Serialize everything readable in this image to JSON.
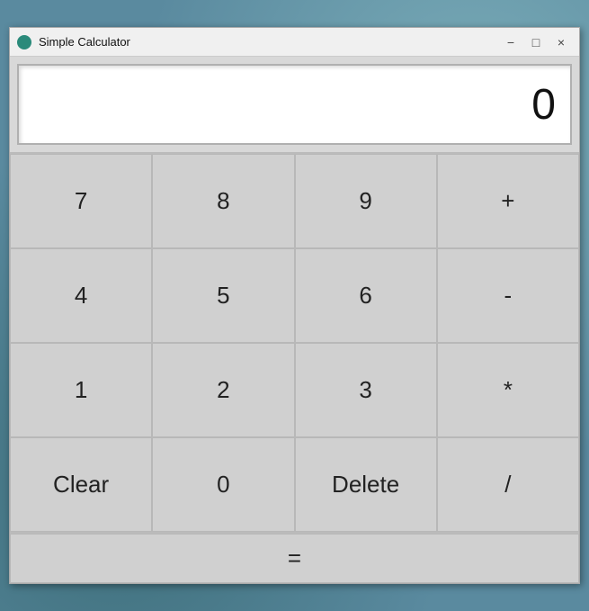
{
  "window": {
    "title": "Simple Calculator",
    "icon": "●"
  },
  "titlebar": {
    "minimize_label": "−",
    "maximize_label": "□",
    "close_label": "×"
  },
  "display": {
    "value": "0"
  },
  "buttons": {
    "row1": [
      {
        "label": "7",
        "id": "btn-7"
      },
      {
        "label": "8",
        "id": "btn-8"
      },
      {
        "label": "9",
        "id": "btn-9"
      },
      {
        "label": "+",
        "id": "btn-plus"
      }
    ],
    "row2": [
      {
        "label": "4",
        "id": "btn-4"
      },
      {
        "label": "5",
        "id": "btn-5"
      },
      {
        "label": "6",
        "id": "btn-6"
      },
      {
        "label": "-",
        "id": "btn-minus"
      }
    ],
    "row3": [
      {
        "label": "1",
        "id": "btn-1"
      },
      {
        "label": "2",
        "id": "btn-2"
      },
      {
        "label": "3",
        "id": "btn-3"
      },
      {
        "label": "*",
        "id": "btn-multiply"
      }
    ],
    "row4": [
      {
        "label": "Clear",
        "id": "btn-clear"
      },
      {
        "label": "0",
        "id": "btn-0"
      },
      {
        "label": "Delete",
        "id": "btn-delete"
      },
      {
        "label": "/",
        "id": "btn-divide"
      }
    ],
    "equals": {
      "label": "=",
      "id": "btn-equals"
    }
  }
}
